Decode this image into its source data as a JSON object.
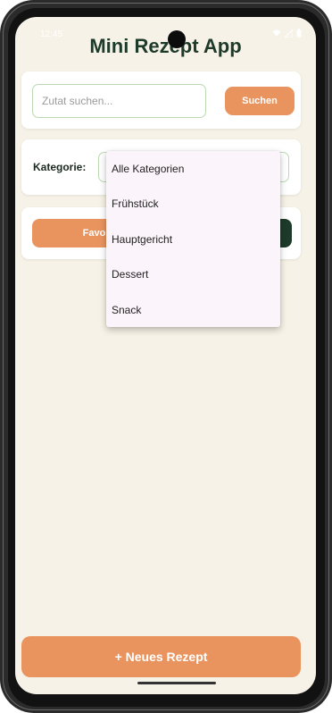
{
  "status_bar": {
    "time": "12:45",
    "icons": [
      "wifi-icon",
      "signal-icon",
      "battery-icon"
    ]
  },
  "app": {
    "title": "Mini Rezept App"
  },
  "search": {
    "placeholder": "Zutat suchen...",
    "value": "",
    "button_label": "Suchen"
  },
  "category": {
    "label": "Kategorie:",
    "selected": "Alle Kategorien",
    "dropdown_open": true,
    "options": [
      "Alle Kategorien",
      "Frühstück",
      "Hauptgericht",
      "Dessert",
      "Snack"
    ]
  },
  "actions": {
    "favorites_label": "Favorit"
  },
  "footer": {
    "new_recipe_label": "+ Neues Rezept"
  },
  "colors": {
    "background": "#f6f2e7",
    "accent_orange": "#e9945f",
    "dark_green": "#1e3a2a",
    "input_border": "#bcd8b2",
    "menu_bg": "#fcf4fb"
  }
}
